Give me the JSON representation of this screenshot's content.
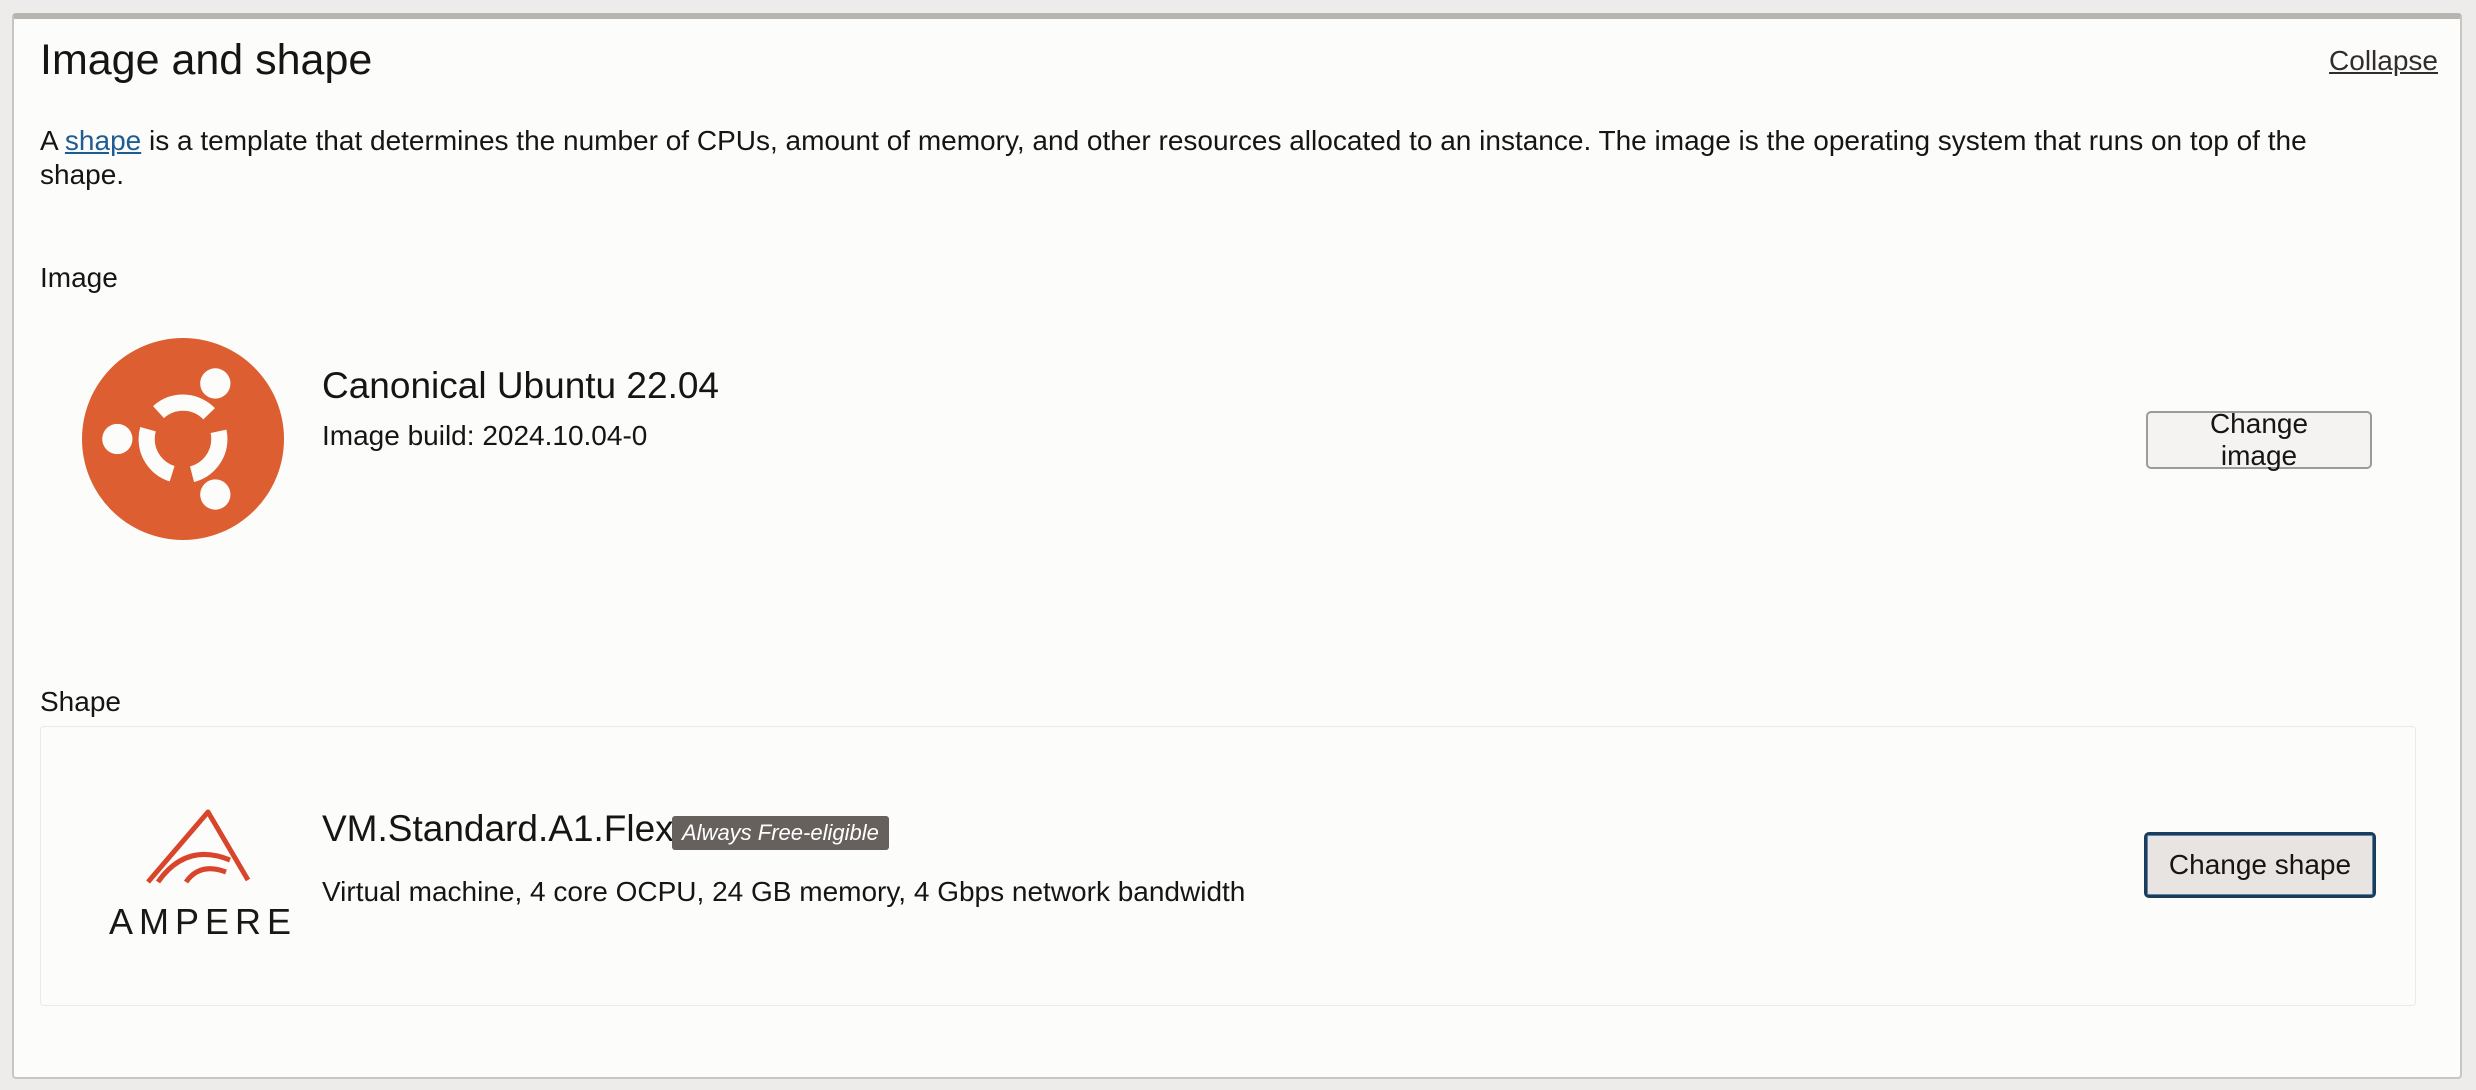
{
  "section": {
    "title": "Image and shape",
    "collapse_label": "Collapse",
    "description": {
      "prefix": "A ",
      "link_text": "shape",
      "suffix": " is a template that determines the number of CPUs, amount of memory, and other resources allocated to an instance. The image is the operating system that runs on top of the shape."
    }
  },
  "image": {
    "label": "Image",
    "logo_icon": "ubuntu-logo-icon",
    "name": "Canonical Ubuntu 22.04",
    "build": "Image build: 2024.10.04-0",
    "change_button": "Change image",
    "logo_color": "#dc5e31"
  },
  "shape": {
    "label": "Shape",
    "logo_icon": "ampere-logo-icon",
    "logo_text": "AMPERE",
    "name": "VM.Standard.A1.Flex",
    "badge": "Always Free-eligible",
    "details": "Virtual machine, 4 core OCPU, 24 GB memory, 4 Gbps network bandwidth",
    "change_button": "Change shape",
    "logo_color": "#d9452a"
  }
}
